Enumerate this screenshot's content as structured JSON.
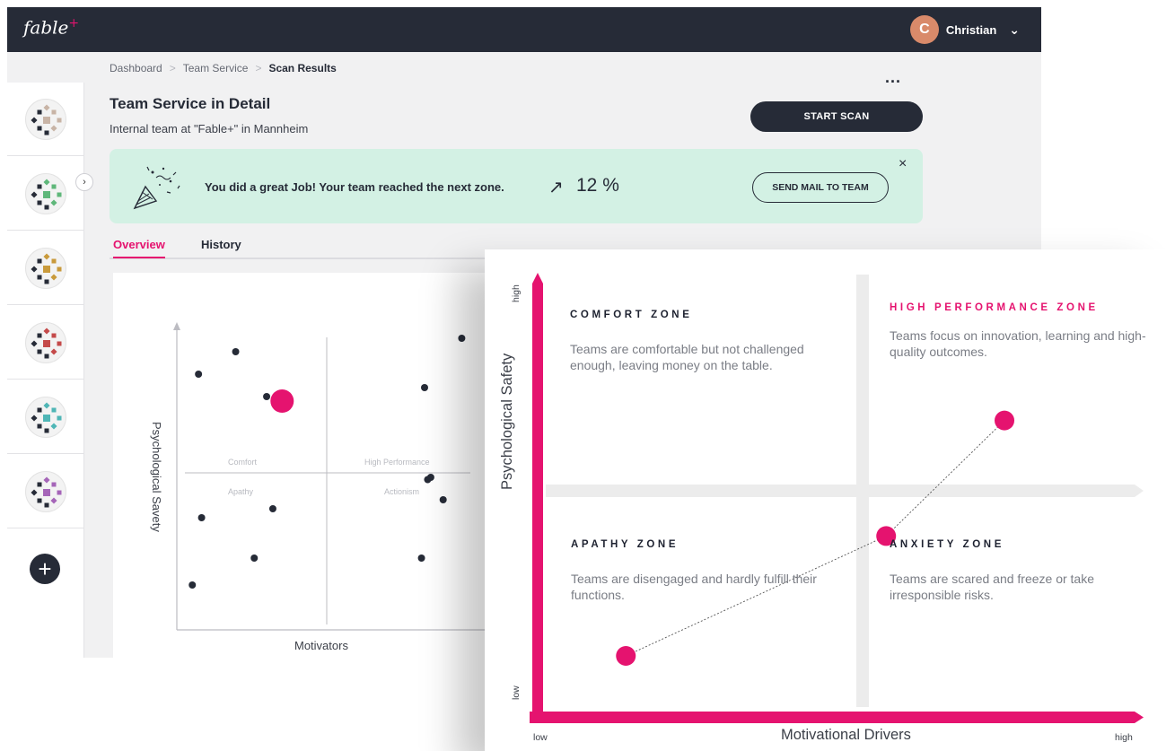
{
  "topbar": {
    "logo_text": "fable",
    "logo_plus": "+",
    "user_initial": "C",
    "user_name": "Christian"
  },
  "sidebar": {
    "items": [
      {
        "icon": "team-pattern-1-icon"
      },
      {
        "icon": "team-pattern-2-icon"
      },
      {
        "icon": "team-pattern-3-icon"
      },
      {
        "icon": "team-pattern-4-icon"
      },
      {
        "icon": "team-pattern-5-icon"
      },
      {
        "icon": "team-pattern-6-icon"
      }
    ],
    "expand_icon": "chevron-right-icon",
    "add_icon": "plus-icon"
  },
  "breadcrumb": [
    "Dashboard",
    "Team Service",
    "Scan Results"
  ],
  "header": {
    "title": "Team Service in Detail",
    "subtitle": "Internal team at \"Fable+\" in Mannheim",
    "start_scan": "START SCAN",
    "more": "..."
  },
  "banner": {
    "message": "You did a great Job! Your team reached the next zone.",
    "trend_arrow": "↗",
    "trend_value": "12 %",
    "mail_button": "SEND MAIL TO TEAM",
    "close": "×"
  },
  "tabs": [
    {
      "label": "Overview",
      "active": true
    },
    {
      "label": "History",
      "active": false
    }
  ],
  "mini_chart": {
    "type": "scatter",
    "xlabel": "Motivators",
    "ylabel": "Psychological Savety",
    "quadrant_labels": [
      "Comfort",
      "High Performance",
      "Apathy",
      "Actionism"
    ],
    "x": [
      0.35,
      0.95,
      1.45,
      4.0,
      4.6,
      4.1,
      0.4,
      1.55,
      0.25,
      1.25,
      4.05,
      4.3,
      3.95
    ],
    "y": [
      5.7,
      6.2,
      5.2,
      5.4,
      6.5,
      3.4,
      2.5,
      2.7,
      1.0,
      1.6,
      3.35,
      2.9,
      1.6
    ],
    "highlight": {
      "x": 1.7,
      "y": 5.1
    }
  },
  "chart_data": {
    "type": "scatter",
    "xlabel": "Motivational Drivers",
    "ylabel": "Psychological Safety",
    "x_tick_low": "low",
    "x_tick_high": "high",
    "y_tick_low": "low",
    "y_tick_high": "high",
    "quadrants": [
      {
        "title": "COMFORT ZONE",
        "desc": "Teams are comfortable but not challenged enough, leaving money on the table."
      },
      {
        "title": "HIGH PERFORMANCE ZONE",
        "desc": "Teams focus on innovation, learning and high-quality outcomes."
      },
      {
        "title": "APATHY ZONE",
        "desc": "Teams are disengaged and hardly fulfill their functions."
      },
      {
        "title": "ANXIETY ZONE",
        "desc": "Teams are scared and freeze or take irresponsible risks."
      }
    ],
    "path_points": [
      {
        "x": 0.14,
        "y": 0.13
      },
      {
        "x": 0.58,
        "y": 0.41
      },
      {
        "x": 0.78,
        "y": 0.68
      }
    ],
    "accent_color": "#e5136f"
  }
}
